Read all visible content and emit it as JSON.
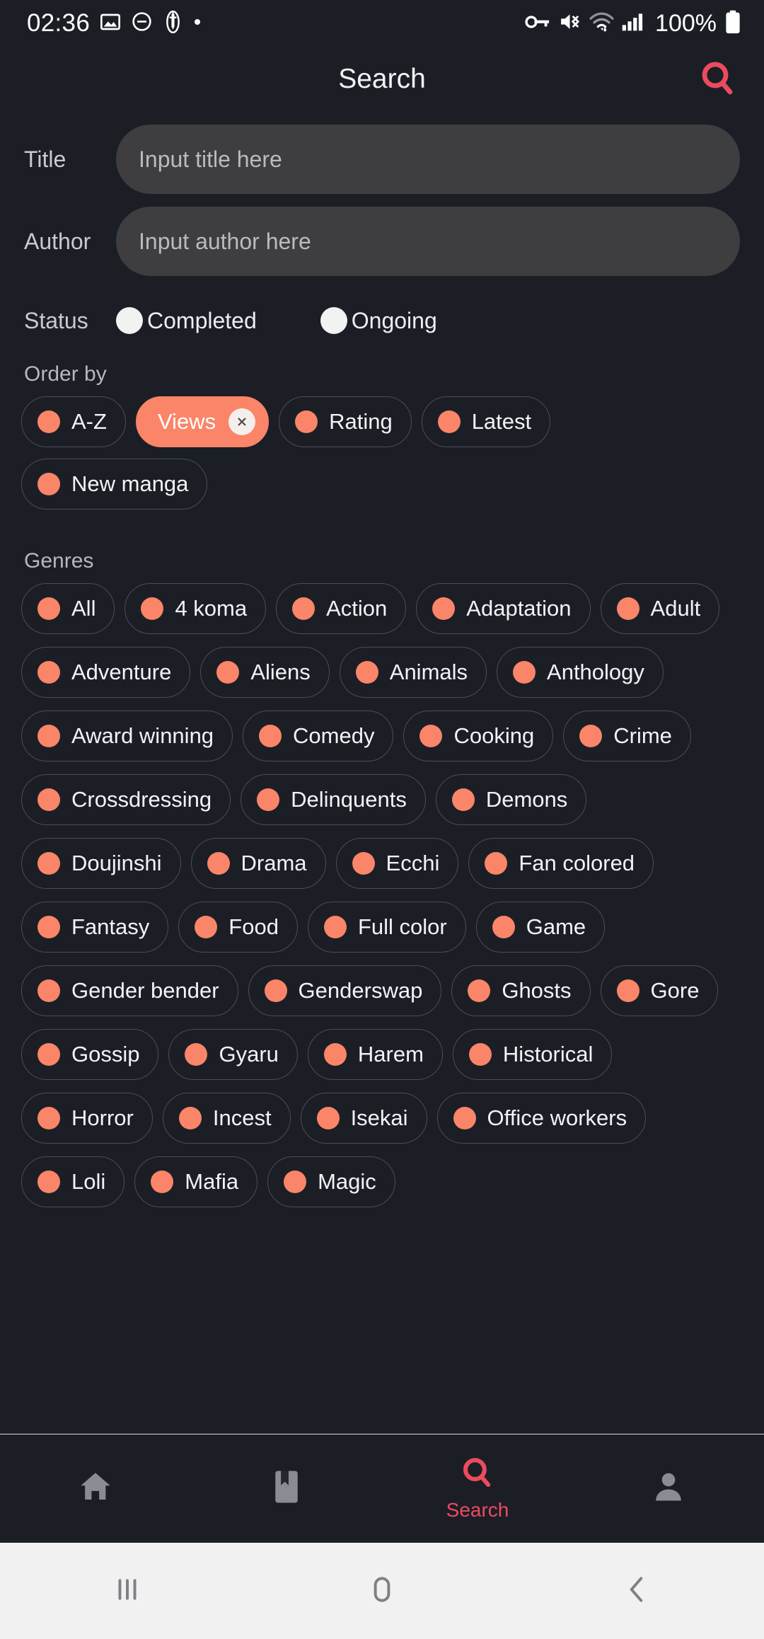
{
  "statusbar": {
    "time": "02:36",
    "battery_percent": "100%",
    "left_icons": [
      "image-icon",
      "do-not-disturb-icon",
      "sword-person-icon",
      "dot-icon"
    ],
    "right_icons": [
      "vpn-key-icon",
      "mute-vibrate-icon",
      "wifi-icon",
      "signal-bars-icon",
      "battery-icon"
    ]
  },
  "header": {
    "title": "Search",
    "search_icon": "search-icon",
    "accent": "#ec4b5e"
  },
  "colors": {
    "background": "#1c1e26",
    "chip_accent": "#fa8568",
    "input_fill": "#3e3e40",
    "nav_active": "#ec4b5e"
  },
  "form": {
    "title": {
      "label": "Title",
      "placeholder": "Input title here",
      "value": ""
    },
    "author": {
      "label": "Author",
      "placeholder": "Input author here",
      "value": ""
    },
    "status": {
      "label": "Status",
      "options": [
        {
          "label": "Completed",
          "selected": false
        },
        {
          "label": "Ongoing",
          "selected": false
        }
      ]
    }
  },
  "order_by": {
    "title": "Order by",
    "chips": [
      {
        "label": "A-Z",
        "selected": false
      },
      {
        "label": "Views",
        "selected": true
      },
      {
        "label": "Rating",
        "selected": false
      },
      {
        "label": "Latest",
        "selected": false
      },
      {
        "label": "New manga",
        "selected": false
      }
    ]
  },
  "genres": {
    "title": "Genres",
    "chips": [
      {
        "label": "All",
        "selected": false
      },
      {
        "label": "4 koma",
        "selected": false
      },
      {
        "label": "Action",
        "selected": false
      },
      {
        "label": "Adaptation",
        "selected": false
      },
      {
        "label": "Adult",
        "selected": false
      },
      {
        "label": "Adventure",
        "selected": false
      },
      {
        "label": "Aliens",
        "selected": false
      },
      {
        "label": "Animals",
        "selected": false
      },
      {
        "label": "Anthology",
        "selected": false
      },
      {
        "label": "Award winning",
        "selected": false
      },
      {
        "label": "Comedy",
        "selected": false
      },
      {
        "label": "Cooking",
        "selected": false
      },
      {
        "label": "Crime",
        "selected": false
      },
      {
        "label": "Crossdressing",
        "selected": false
      },
      {
        "label": "Delinquents",
        "selected": false
      },
      {
        "label": "Demons",
        "selected": false
      },
      {
        "label": "Doujinshi",
        "selected": false
      },
      {
        "label": "Drama",
        "selected": false
      },
      {
        "label": "Ecchi",
        "selected": false
      },
      {
        "label": "Fan colored",
        "selected": false
      },
      {
        "label": "Fantasy",
        "selected": false
      },
      {
        "label": "Food",
        "selected": false
      },
      {
        "label": "Full color",
        "selected": false
      },
      {
        "label": "Game",
        "selected": false
      },
      {
        "label": "Gender bender",
        "selected": false
      },
      {
        "label": "Genderswap",
        "selected": false
      },
      {
        "label": "Ghosts",
        "selected": false
      },
      {
        "label": "Gore",
        "selected": false
      },
      {
        "label": "Gossip",
        "selected": false
      },
      {
        "label": "Gyaru",
        "selected": false
      },
      {
        "label": "Harem",
        "selected": false
      },
      {
        "label": "Historical",
        "selected": false
      },
      {
        "label": "Horror",
        "selected": false
      },
      {
        "label": "Incest",
        "selected": false
      },
      {
        "label": "Isekai",
        "selected": false
      },
      {
        "label": "Office workers",
        "selected": false
      },
      {
        "label": "Loli",
        "selected": false
      },
      {
        "label": "Mafia",
        "selected": false
      },
      {
        "label": "Magic",
        "selected": false
      }
    ]
  },
  "bottom_nav": {
    "items": [
      {
        "icon": "home-icon",
        "label": "",
        "active": false
      },
      {
        "icon": "bookmark-icon",
        "label": "",
        "active": false
      },
      {
        "icon": "search-icon",
        "label": "Search",
        "active": true
      },
      {
        "icon": "person-icon",
        "label": "",
        "active": false
      }
    ]
  },
  "android_nav": {
    "items": [
      "recents-icon",
      "home-icon",
      "back-icon"
    ]
  }
}
